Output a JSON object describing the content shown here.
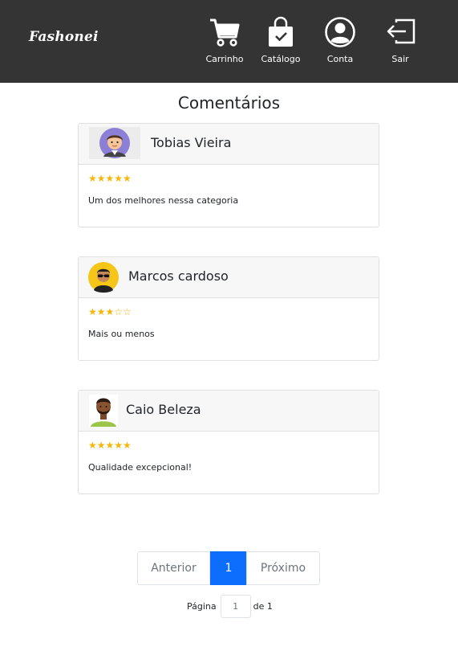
{
  "brand": "Fashonei",
  "nav": {
    "cart": {
      "label": "Carrinho",
      "icon": "cart-icon"
    },
    "catalog": {
      "label": "Catálogo",
      "icon": "shopping-bag-icon"
    },
    "account": {
      "label": "Conta",
      "icon": "user-icon"
    },
    "exit": {
      "label": "Sair",
      "icon": "sign-out-icon"
    }
  },
  "page_title": "Comentários",
  "reviews": [
    {
      "author": "Tobias Vieira",
      "rating": 5,
      "stars": "★★★★★",
      "comment": "Um dos melhores nessa categoria",
      "avatar": "avatar-man-purple"
    },
    {
      "author": "Marcos cardoso",
      "rating": 3,
      "stars": "★★★☆☆",
      "comment": "Mais ou menos",
      "avatar": "avatar-man-sunglasses"
    },
    {
      "author": "Caio Beleza",
      "rating": 5,
      "stars": "★★★★★",
      "comment": "Qualidade excepcional!",
      "avatar": "avatar-man-beard"
    }
  ],
  "pagination": {
    "previous": "Anterior",
    "current": "1",
    "next": "Próximo",
    "page_label": "Página",
    "page_value": "1",
    "of_label": "de 1"
  },
  "colors": {
    "navbar": "#343434",
    "accent": "#0d6efd",
    "star": "#f5b70b"
  }
}
